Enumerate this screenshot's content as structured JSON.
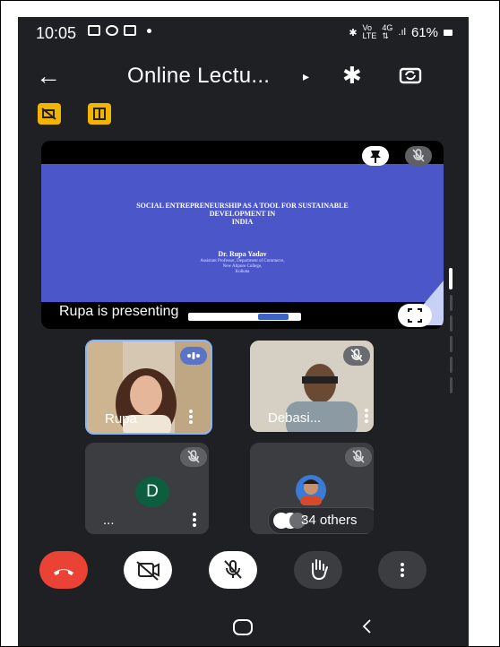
{
  "status_bar": {
    "time": "10:05",
    "battery": "61%",
    "right_icons": "✱ ມ ມ .∣"
  },
  "header": {
    "back_label": "←",
    "title": "Online Lectu...",
    "caret": "▸",
    "bluetooth_label": "✱"
  },
  "presentation": {
    "slide_title_line1": "SOCIAL ENTREPRENEURSHIP AS A TOOL FOR SUSTAINABLE",
    "slide_title_line2": "DEVELOPMENT IN",
    "slide_title_line3": "INDIA",
    "slide_author": "Dr. Rupa Yadav",
    "slide_sub_line1": "Assistant Professor, Department of Commerce,",
    "slide_sub_line2": "New Alipore College,",
    "slide_sub_line3": "Kolkata",
    "label": "Rupa is presenting"
  },
  "tiles": [
    {
      "name": "Rupa"
    },
    {
      "name": "Debasi..."
    },
    {
      "name": "...",
      "avatar_letter": "D"
    },
    {
      "name": "34 others"
    }
  ],
  "colors": {
    "background": "#1f2023",
    "end_call": "#ea4335",
    "badge": "#f2b400",
    "slide": "#4b57c9"
  },
  "icons": [
    "back-arrow-icon",
    "bluetooth-icon",
    "switch-camera-icon",
    "end-call-icon",
    "camera-off-icon",
    "mic-off-icon",
    "raise-hand-icon",
    "more-options-icon",
    "pin-icon",
    "expand-icon"
  ]
}
